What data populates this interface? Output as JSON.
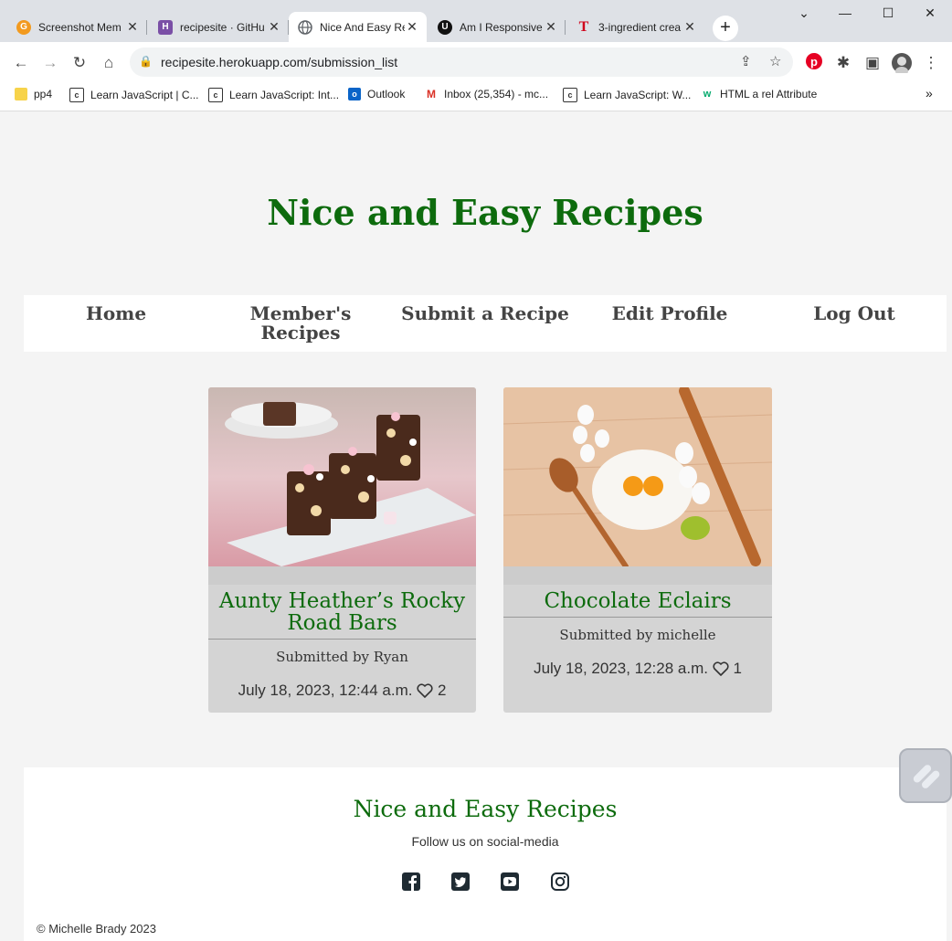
{
  "browser": {
    "tabs": [
      {
        "title": "Screenshot Mem",
        "favicon_color": "#f29a1f",
        "favicon_glyph": "G"
      },
      {
        "title": "recipesite · GitHu",
        "favicon_color": "#7a4fa6",
        "favicon_glyph": "H"
      },
      {
        "title": "Nice And Easy Re",
        "favicon_color": "#5f6368",
        "favicon_glyph": ""
      },
      {
        "title": "Am I Responsive",
        "favicon_color": "#111111",
        "favicon_glyph": "U"
      },
      {
        "title": "3-ingredient crea",
        "favicon_color": "#ffffff",
        "favicon_glyph": "T"
      }
    ],
    "url": "recipesite.herokuapp.com/submission_list",
    "bookmarks": [
      {
        "label": "pp4",
        "icon": "folder-icon"
      },
      {
        "label": "Learn JavaScript | C...",
        "icon": "codecademy-icon"
      },
      {
        "label": "Learn JavaScript: Int...",
        "icon": "codecademy-icon"
      },
      {
        "label": "Outlook",
        "icon": "outlook-icon"
      },
      {
        "label": "Inbox (25,354) - mc...",
        "icon": "gmail-icon"
      },
      {
        "label": "Learn JavaScript: W...",
        "icon": "codecademy-icon"
      },
      {
        "label": "HTML a rel Attribute",
        "icon": "w3schools-icon"
      }
    ],
    "more_bookmarks": "»"
  },
  "site": {
    "title": "Nice and Easy Recipes",
    "nav": {
      "home": "Home",
      "members_line1": "Member's",
      "members_line2": "Recipes",
      "submit": "Submit a Recipe",
      "edit": "Edit Profile",
      "logout": "Log Out"
    },
    "cards": [
      {
        "title_line1": "Aunty Heather’s Rocky",
        "title_line2": "Road Bars",
        "submitted": "Submitted by Ryan",
        "date": "July 18, 2023, 12:44 a.m.",
        "likes": "2"
      },
      {
        "title_line1": "Chocolate Eclairs",
        "submitted": "Submitted by michelle",
        "date": "July 18, 2023, 12:28 a.m.",
        "likes": "1"
      }
    ],
    "footer": {
      "title": "Nice and Easy Recipes",
      "follow": "Follow us on social-media",
      "copyright": "© Michelle Brady 2023"
    }
  },
  "colors": {
    "brand_green": "#0d6b0d",
    "nav_text": "#444444",
    "card_bg": "#d4d4d4"
  }
}
